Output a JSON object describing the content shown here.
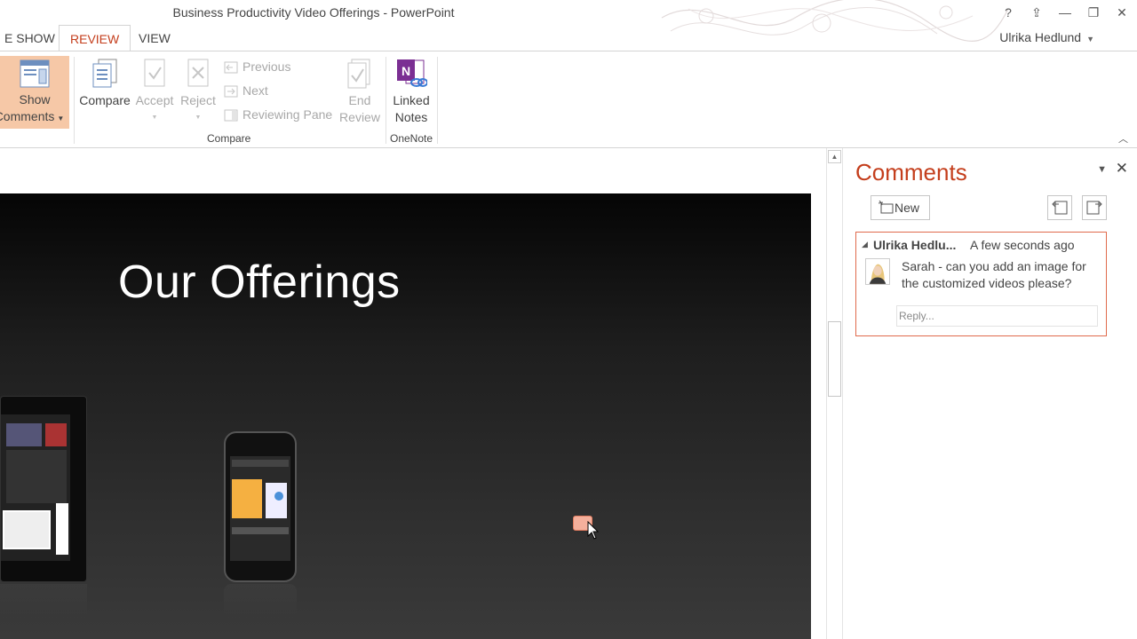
{
  "window": {
    "title": "Business Productivity Video Offerings - PowerPoint",
    "controls": {
      "help": "?",
      "ribbon_options": "⇪",
      "minimize": "—",
      "restore": "❐",
      "close": "✕"
    }
  },
  "tabs": [
    {
      "label": "E SHOW"
    },
    {
      "label": "REVIEW"
    },
    {
      "label": "VIEW"
    }
  ],
  "user": {
    "name": "Ulrika Hedlund"
  },
  "ribbon": {
    "show_comments": {
      "line1": "Show",
      "line2": "Comments"
    },
    "compare": {
      "label": "Compare"
    },
    "accept": {
      "label": "Accept"
    },
    "reject": {
      "label": "Reject"
    },
    "previous": {
      "label": "Previous"
    },
    "next": {
      "label": "Next"
    },
    "reviewing_pane": {
      "label": "Reviewing Pane"
    },
    "end_review": {
      "line1": "End",
      "line2": "Review"
    },
    "linked_notes": {
      "line1": "Linked",
      "line2": "Notes"
    },
    "groups": {
      "compare": "Compare",
      "onenote": "OneNote"
    }
  },
  "slide": {
    "title": "Our Offerings"
  },
  "comments_pane": {
    "title": "Comments",
    "new_label": "New",
    "comment": {
      "author": "Ulrika Hedlu...",
      "time": "A few seconds ago",
      "text": "Sarah - can you add an image for the customized videos please?",
      "reply_placeholder": "Reply..."
    }
  },
  "colors": {
    "accent": "#c43e1c",
    "show_comments_active_bg": "#f6c8a7",
    "comment_border": "#e06a4c",
    "onenote_purple": "#7b2f93"
  }
}
